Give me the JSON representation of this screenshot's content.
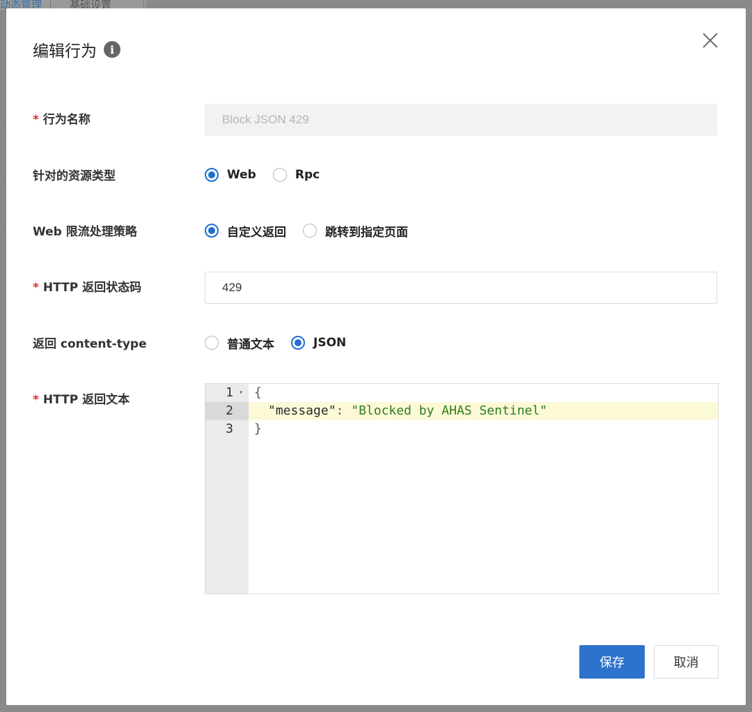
{
  "background": {
    "tabs": [
      "动态管理",
      "基础设置"
    ]
  },
  "dialog": {
    "title": "编辑行为",
    "info_icon": "i",
    "close_icon": "close-icon"
  },
  "form": {
    "required_mark": "*",
    "name": {
      "label": "行为名称",
      "value": "Block JSON 429",
      "disabled": true
    },
    "resource_type": {
      "label": "针对的资源类型",
      "options": [
        "Web",
        "Rpc"
      ],
      "selected": "Web"
    },
    "web_strategy": {
      "label": "Web 限流处理策略",
      "options": [
        "自定义返回",
        "跳转到指定页面"
      ],
      "selected": "自定义返回"
    },
    "http_status": {
      "label": "HTTP 返回状态码",
      "value": "429"
    },
    "content_type": {
      "label": "返回 content-type",
      "options": [
        "普通文本",
        "JSON"
      ],
      "selected": "JSON"
    },
    "http_body": {
      "label": "HTTP 返回文本",
      "line_numbers": [
        "1",
        "2",
        "3"
      ],
      "lines": {
        "open": "{",
        "key": "\"message\"",
        "colon": ": ",
        "value": "\"Blocked by AHAS Sentinel\"",
        "close": "}"
      }
    }
  },
  "buttons": {
    "save": "保存",
    "cancel": "取消"
  },
  "colors": {
    "primary": "#2d73cc",
    "required": "#d93026",
    "radio_checked": "#1f6fd0",
    "string_token": "#2e7d1e",
    "active_line": "#fcf9d7"
  }
}
